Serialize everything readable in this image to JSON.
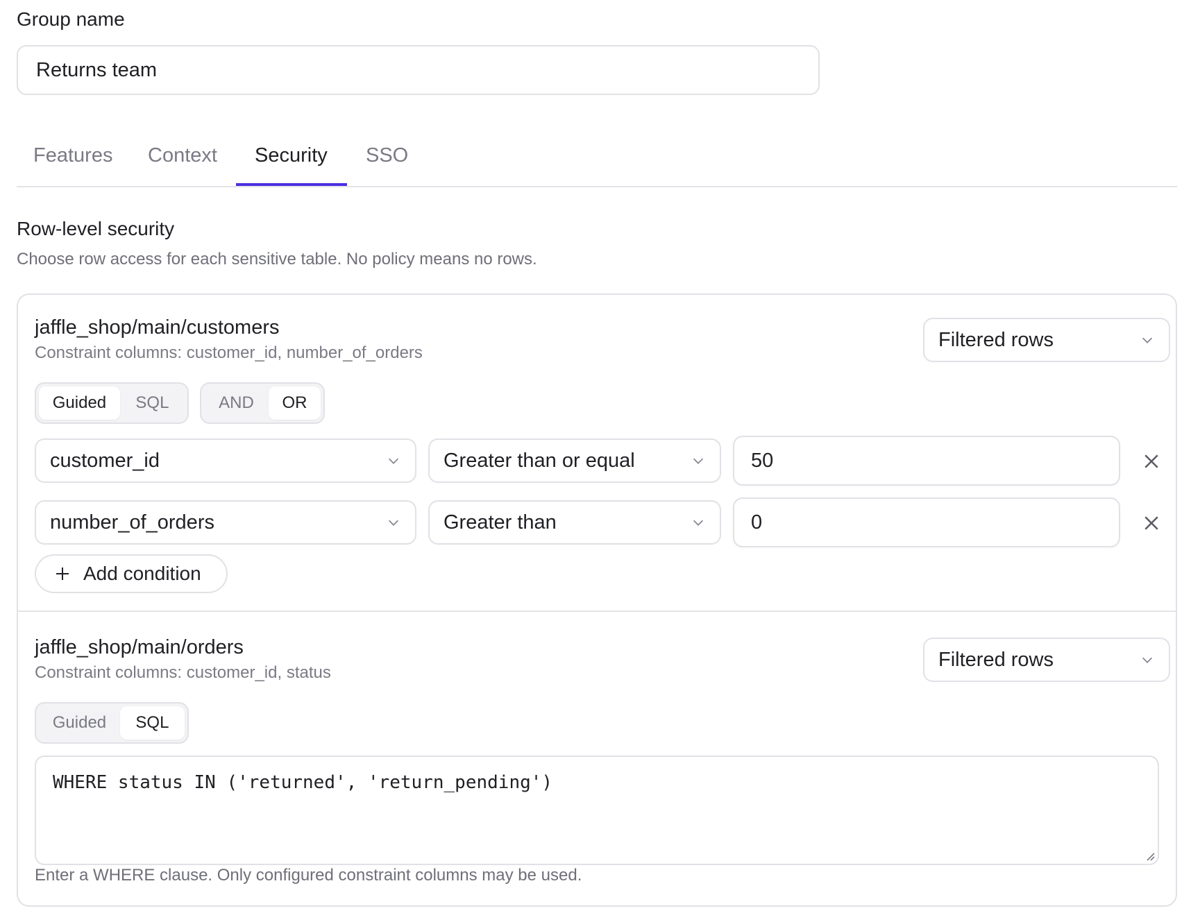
{
  "group": {
    "label": "Group name",
    "value": "Returns team"
  },
  "tabs": [
    {
      "label": "Features",
      "active": false
    },
    {
      "label": "Context",
      "active": false
    },
    {
      "label": "Security",
      "active": true
    },
    {
      "label": "SSO",
      "active": false
    }
  ],
  "security": {
    "title": "Row-level security",
    "description": "Choose row access for each sensitive table. No policy means no rows.",
    "tables": [
      {
        "name": "jaffle_shop/main/customers",
        "constraints": "Constraint columns: customer_id, number_of_orders",
        "access": "Filtered rows",
        "mode_options": [
          "Guided",
          "SQL"
        ],
        "mode_selected": "Guided",
        "logic_options": [
          "AND",
          "OR"
        ],
        "logic_selected": "OR",
        "conditions": [
          {
            "column": "customer_id",
            "operator": "Greater than or equal",
            "value": "50"
          },
          {
            "column": "number_of_orders",
            "operator": "Greater than",
            "value": "0"
          }
        ],
        "add_label": "Add condition"
      },
      {
        "name": "jaffle_shop/main/orders",
        "constraints": "Constraint columns: customer_id, status",
        "access": "Filtered rows",
        "mode_options": [
          "Guided",
          "SQL"
        ],
        "mode_selected": "SQL",
        "sql": "WHERE status IN ('returned', 'return_pending')",
        "sql_help": "Enter a WHERE clause. Only configured constraint columns may be used."
      }
    ]
  },
  "colors": {
    "accent": "#4b2ee0",
    "border": "#e1e1e6",
    "muted_text": "#7a7a84"
  },
  "icons": [
    "chevron-down-icon",
    "close-icon",
    "plus-icon",
    "resize-grip-icon"
  ]
}
